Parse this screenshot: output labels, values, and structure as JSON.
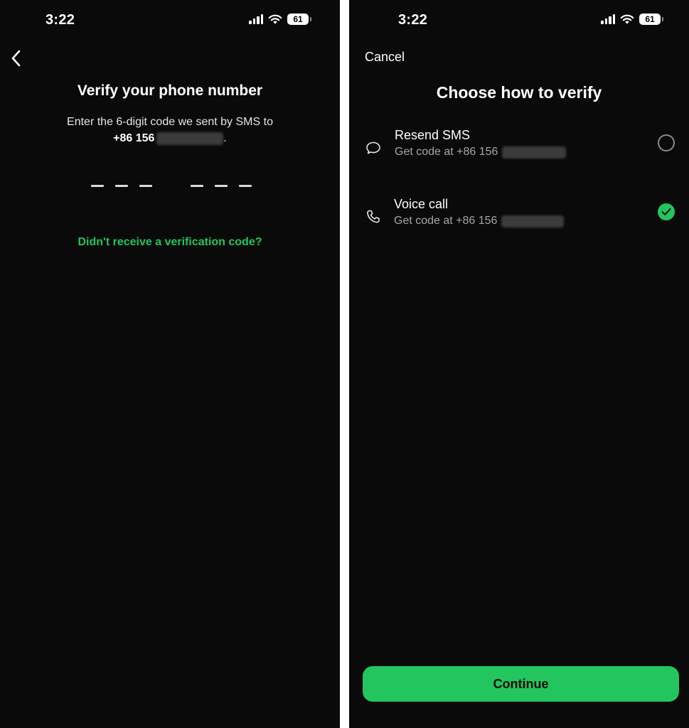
{
  "status_bar": {
    "time": "3:22",
    "battery": "61"
  },
  "verify_screen": {
    "title": "Verify your phone number",
    "instruction": "Enter the 6-digit code we sent by SMS to",
    "phone_prefix": "+86 156",
    "phone_suffix": ".",
    "resend_link": "Didn't receive a verification code?"
  },
  "choose_screen": {
    "cancel_label": "Cancel",
    "title": "Choose how to verify",
    "options": [
      {
        "label": "Resend SMS",
        "sub": "Get code at +86 156",
        "icon": "chat-bubble-icon",
        "selected": false
      },
      {
        "label": "Voice call",
        "sub": "Get code at +86 156",
        "icon": "phone-icon",
        "selected": true
      }
    ],
    "continue_label": "Continue"
  },
  "colors": {
    "background": "#0a0a0a",
    "accent": "#22c55e",
    "text_primary": "#ffffff",
    "text_secondary": "#a6a6a6"
  }
}
